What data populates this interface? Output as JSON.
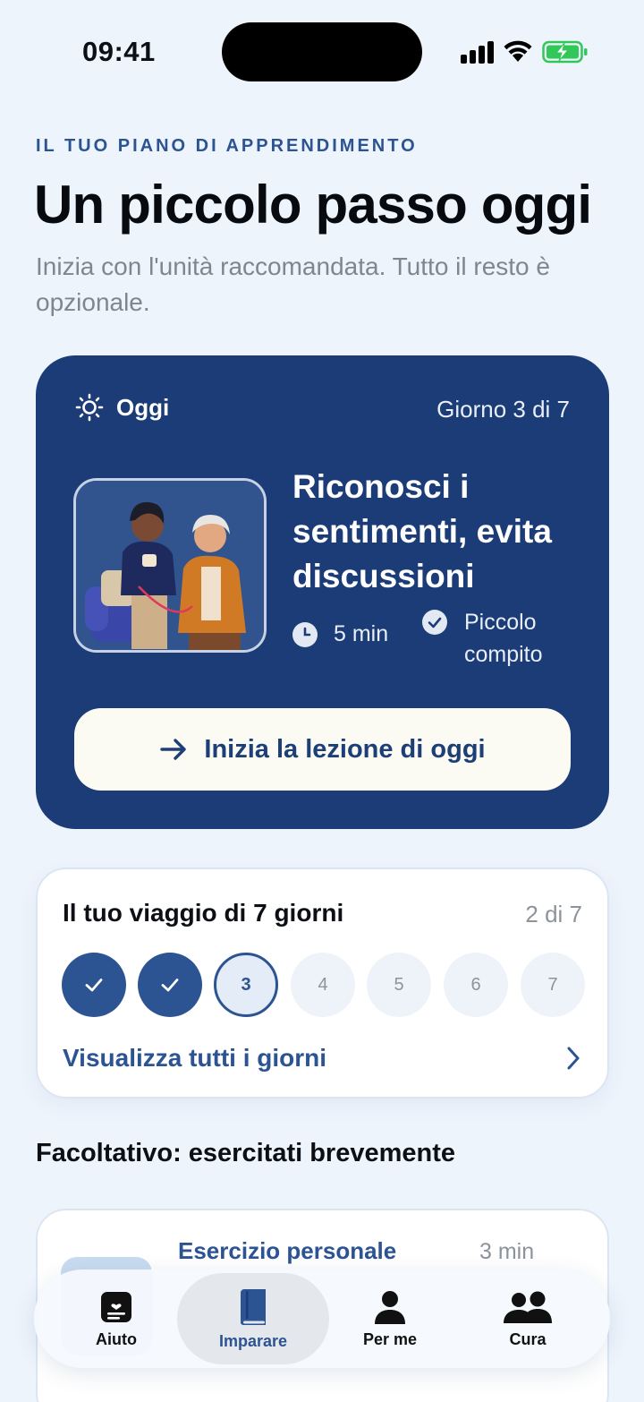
{
  "status_bar": {
    "time": "09:41",
    "battery_color": "#32c759"
  },
  "header": {
    "overline": "IL TUO PIANO DI APPRENDIMENTO",
    "title": "Un piccolo passo oggi",
    "subtitle": "Inizia con l'unità raccomandata. Tutto il resto è opzionale."
  },
  "today_card": {
    "label": "Oggi",
    "icon": "sun-icon",
    "day_counter": "Giorno 3 di 7",
    "lesson_title": "Riconosci i sentimenti, evita discussioni",
    "duration": "5 min",
    "task": "Piccolo compito",
    "start_button": "Inizia la lezione di oggi",
    "background_color": "#1b3c77"
  },
  "journey": {
    "title": "Il tuo viaggio di 7 giorni",
    "count": "2 di 7",
    "days": [
      {
        "label": "✓",
        "state": "done"
      },
      {
        "label": "✓",
        "state": "done"
      },
      {
        "label": "3",
        "state": "current"
      },
      {
        "label": "4",
        "state": "future"
      },
      {
        "label": "5",
        "state": "future"
      },
      {
        "label": "6",
        "state": "future"
      },
      {
        "label": "7",
        "state": "future"
      }
    ],
    "link": "Visualizza tutti i giorni"
  },
  "optional_section": {
    "title": "Facoltativo: esercitati brevemente",
    "card": {
      "title": "Esercizio personale",
      "time": "3 min"
    }
  },
  "tab_bar": {
    "tabs": [
      {
        "label": "Aiuto",
        "icon": "help-card-icon"
      },
      {
        "label": "Imparare",
        "icon": "book-icon",
        "active": true
      },
      {
        "label": "Per me",
        "icon": "person-icon"
      },
      {
        "label": "Cura",
        "icon": "people-icon"
      }
    ]
  },
  "accent_color": "#2c5392"
}
